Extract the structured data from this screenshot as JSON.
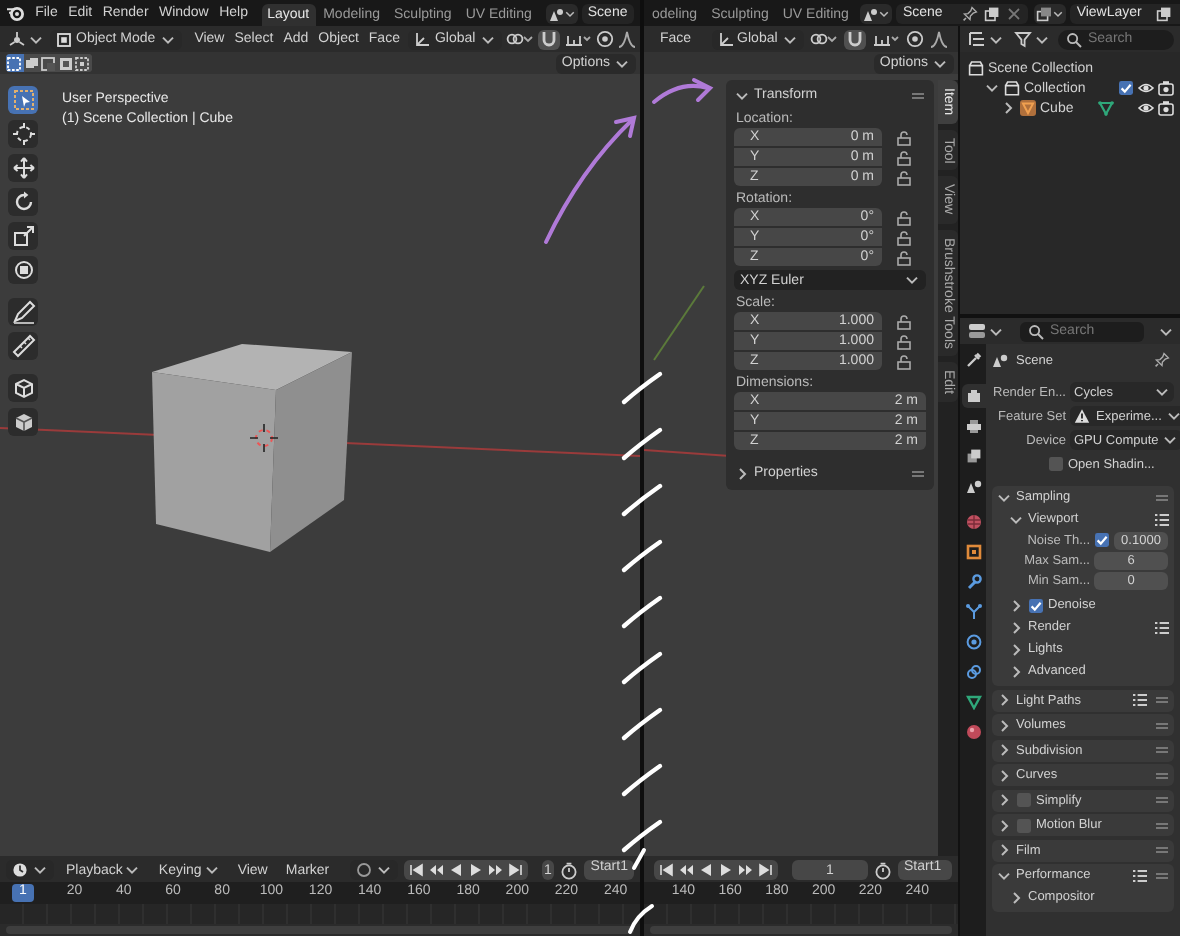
{
  "top_bar": {
    "left": {
      "menus": [
        "File",
        "Edit",
        "Render",
        "Window",
        "Help"
      ],
      "workspace_tabs": [
        {
          "label": "Layout",
          "selected": true
        },
        {
          "label": "Modeling",
          "selected": false
        },
        {
          "label": "Sculpting",
          "selected": false
        },
        {
          "label": "UV Editing",
          "selected": false
        }
      ],
      "scene": "Scene"
    },
    "right": {
      "workspace_tabs": [
        {
          "label": "odeling",
          "selected": false
        },
        {
          "label": "Sculpting",
          "selected": false
        },
        {
          "label": "UV Editing",
          "selected": false
        }
      ],
      "scene": "Scene",
      "view_layer": "ViewLayer"
    }
  },
  "viewport": {
    "mode": "Object Mode",
    "menus": [
      "View",
      "Select",
      "Add",
      "Object",
      "Face"
    ],
    "orientation": "Global",
    "options": "Options",
    "select_modes": [
      {
        "selected": true
      },
      {
        "selected": false
      },
      {
        "selected": false
      },
      {
        "selected": false
      },
      {
        "selected": false
      }
    ],
    "tools": [
      {
        "kind": "select",
        "selected": true
      },
      {
        "kind": "cursor",
        "selected": false
      },
      {
        "kind": "move",
        "selected": false
      },
      {
        "kind": "rotate",
        "selected": false
      },
      {
        "kind": "scale",
        "selected": false
      },
      {
        "kind": "transform",
        "selected": false
      },
      {
        "kind": "annotate",
        "selected": false
      },
      {
        "kind": "measure",
        "selected": false
      },
      {
        "kind": "add-cube",
        "selected": false
      },
      {
        "kind": "extra-cube",
        "selected": false
      }
    ],
    "overlay_title": "User Perspective",
    "overlay_subtitle": "(1) Scene Collection | Cube"
  },
  "viewport_right": {
    "menus": [
      "Face"
    ],
    "orientation": "Global",
    "options": "Options",
    "sidebar": {
      "tabs": [
        {
          "label": "Item",
          "selected": true
        },
        {
          "label": "Tool",
          "selected": false
        },
        {
          "label": "View",
          "selected": false
        },
        {
          "label": "Brushstroke Tools",
          "selected": false
        },
        {
          "label": "Edit",
          "selected": false
        }
      ],
      "panels": [
        {
          "title": "Transform",
          "expanded": true,
          "groups": [
            {
              "kind": "locked",
              "label": "Location:",
              "fields": [
                {
                  "axis": "X",
                  "value": "0 m"
                },
                {
                  "axis": "Y",
                  "value": "0 m"
                },
                {
                  "axis": "Z",
                  "value": "0 m"
                }
              ]
            },
            {
              "kind": "locked",
              "label": "Rotation:",
              "fields": [
                {
                  "axis": "X",
                  "value": "0°"
                },
                {
                  "axis": "Y",
                  "value": "0°"
                },
                {
                  "axis": "Z",
                  "value": "0°"
                }
              ]
            },
            {
              "kind": "dropdown",
              "value": "XYZ Euler"
            },
            {
              "kind": "locked",
              "label": "Scale:",
              "fields": [
                {
                  "axis": "X",
                  "value": "1.000"
                },
                {
                  "axis": "Y",
                  "value": "1.000"
                },
                {
                  "axis": "Z",
                  "value": "1.000"
                }
              ]
            },
            {
              "kind": "plain",
              "label": "Dimensions:",
              "fields": [
                {
                  "axis": "X",
                  "value": "2 m"
                },
                {
                  "axis": "Y",
                  "value": "2 m"
                },
                {
                  "axis": "Z",
                  "value": "2 m"
                }
              ]
            }
          ]
        },
        {
          "title": "Properties",
          "expanded": false
        }
      ]
    }
  },
  "outliner": {
    "search_placeholder": "Search",
    "items": [
      {
        "label": "Scene Collection",
        "kind": "scene-collection",
        "children": [
          {
            "label": "Collection",
            "kind": "collection",
            "expanded": true,
            "checked": true,
            "children": [
              {
                "label": "Cube",
                "kind": "mesh",
                "expanded": false
              }
            ]
          }
        ]
      }
    ]
  },
  "properties": {
    "search_placeholder": "Search",
    "context": "Scene",
    "tabs": [
      {
        "kind": "tool",
        "selected": false
      },
      {
        "kind": "render",
        "selected": true
      },
      {
        "kind": "output",
        "selected": false
      },
      {
        "kind": "view-layer",
        "selected": false
      },
      {
        "kind": "scene",
        "selected": false
      },
      {
        "kind": "world",
        "selected": false
      },
      {
        "kind": "object",
        "selected": false
      },
      {
        "kind": "modifier",
        "selected": false
      },
      {
        "kind": "particles",
        "selected": false
      },
      {
        "kind": "physics",
        "selected": false
      },
      {
        "kind": "constraint",
        "selected": false
      },
      {
        "kind": "data",
        "selected": false
      },
      {
        "kind": "material",
        "selected": false
      }
    ],
    "fields": [
      {
        "kind": "dropdown",
        "label": "Render En...",
        "value": "Cycles",
        "warning": false
      },
      {
        "kind": "dropdown",
        "label": "Feature Set",
        "value": "Experime...",
        "warning": true
      },
      {
        "kind": "dropdown",
        "label": "Device",
        "value": "GPU Compute",
        "warning": false
      },
      {
        "kind": "checkbox",
        "label": "Open Shadin...",
        "checked": false
      }
    ],
    "panels": [
      {
        "kind": "plain",
        "title": "Sampling",
        "expanded": true,
        "children": [
          {
            "kind": "plain",
            "title": "Viewport",
            "expanded": true,
            "presets": true,
            "rows": [
              {
                "kind": "checkbox-number",
                "label": "Noise Th...",
                "checked": true,
                "value": "0.1000"
              },
              {
                "kind": "number",
                "label": "Max Sam...",
                "value": "6"
              },
              {
                "kind": "number",
                "label": "Min Sam...",
                "value": "0"
              }
            ]
          },
          {
            "kind": "checkbox",
            "title": "Denoise",
            "expanded": false,
            "checked": true
          },
          {
            "kind": "plain",
            "title": "Render",
            "expanded": false,
            "presets": true
          },
          {
            "kind": "plain",
            "title": "Lights",
            "expanded": false
          },
          {
            "kind": "plain",
            "title": "Advanced",
            "expanded": false
          }
        ]
      },
      {
        "kind": "plain",
        "title": "Light Paths",
        "expanded": false,
        "presets": true
      },
      {
        "kind": "plain",
        "title": "Volumes",
        "expanded": false
      },
      {
        "kind": "plain",
        "title": "Subdivision",
        "expanded": false
      },
      {
        "kind": "plain",
        "title": "Curves",
        "expanded": false
      },
      {
        "kind": "checkbox",
        "title": "Simplify",
        "expanded": false,
        "checked": false
      },
      {
        "kind": "checkbox",
        "title": "Motion Blur",
        "expanded": false,
        "checked": false
      },
      {
        "kind": "plain",
        "title": "Film",
        "expanded": false
      },
      {
        "kind": "plain",
        "title": "Performance",
        "expanded": true,
        "presets": true,
        "children": [
          {
            "kind": "plain",
            "title": "Compositor",
            "expanded": false
          }
        ]
      }
    ]
  },
  "timeline": {
    "menus": [
      "Playback",
      "Keying",
      "View",
      "Marker"
    ],
    "current_frame": "1",
    "start_label": "Start",
    "start_frame": "1",
    "ruler": [
      {
        "label": "1",
        "selected": true
      },
      {
        "label": "20",
        "selected": false
      },
      {
        "label": "40",
        "selected": false
      },
      {
        "label": "60",
        "selected": false
      },
      {
        "label": "80",
        "selected": false
      },
      {
        "label": "100",
        "selected": false
      },
      {
        "label": "120",
        "selected": false
      },
      {
        "label": "140",
        "selected": false
      },
      {
        "label": "160",
        "selected": false
      },
      {
        "label": "180",
        "selected": false
      },
      {
        "label": "200",
        "selected": false
      },
      {
        "label": "220",
        "selected": false
      },
      {
        "label": "240",
        "selected": false
      }
    ]
  },
  "timeline_right": {
    "current_frame": "1",
    "start_label": "Start",
    "start_frame": "1",
    "ruler": [
      {
        "label": "140",
        "selected": false
      },
      {
        "label": "160",
        "selected": false
      },
      {
        "label": "180",
        "selected": false
      },
      {
        "label": "200",
        "selected": false
      },
      {
        "label": "220",
        "selected": false
      },
      {
        "label": "240",
        "selected": false
      }
    ]
  }
}
